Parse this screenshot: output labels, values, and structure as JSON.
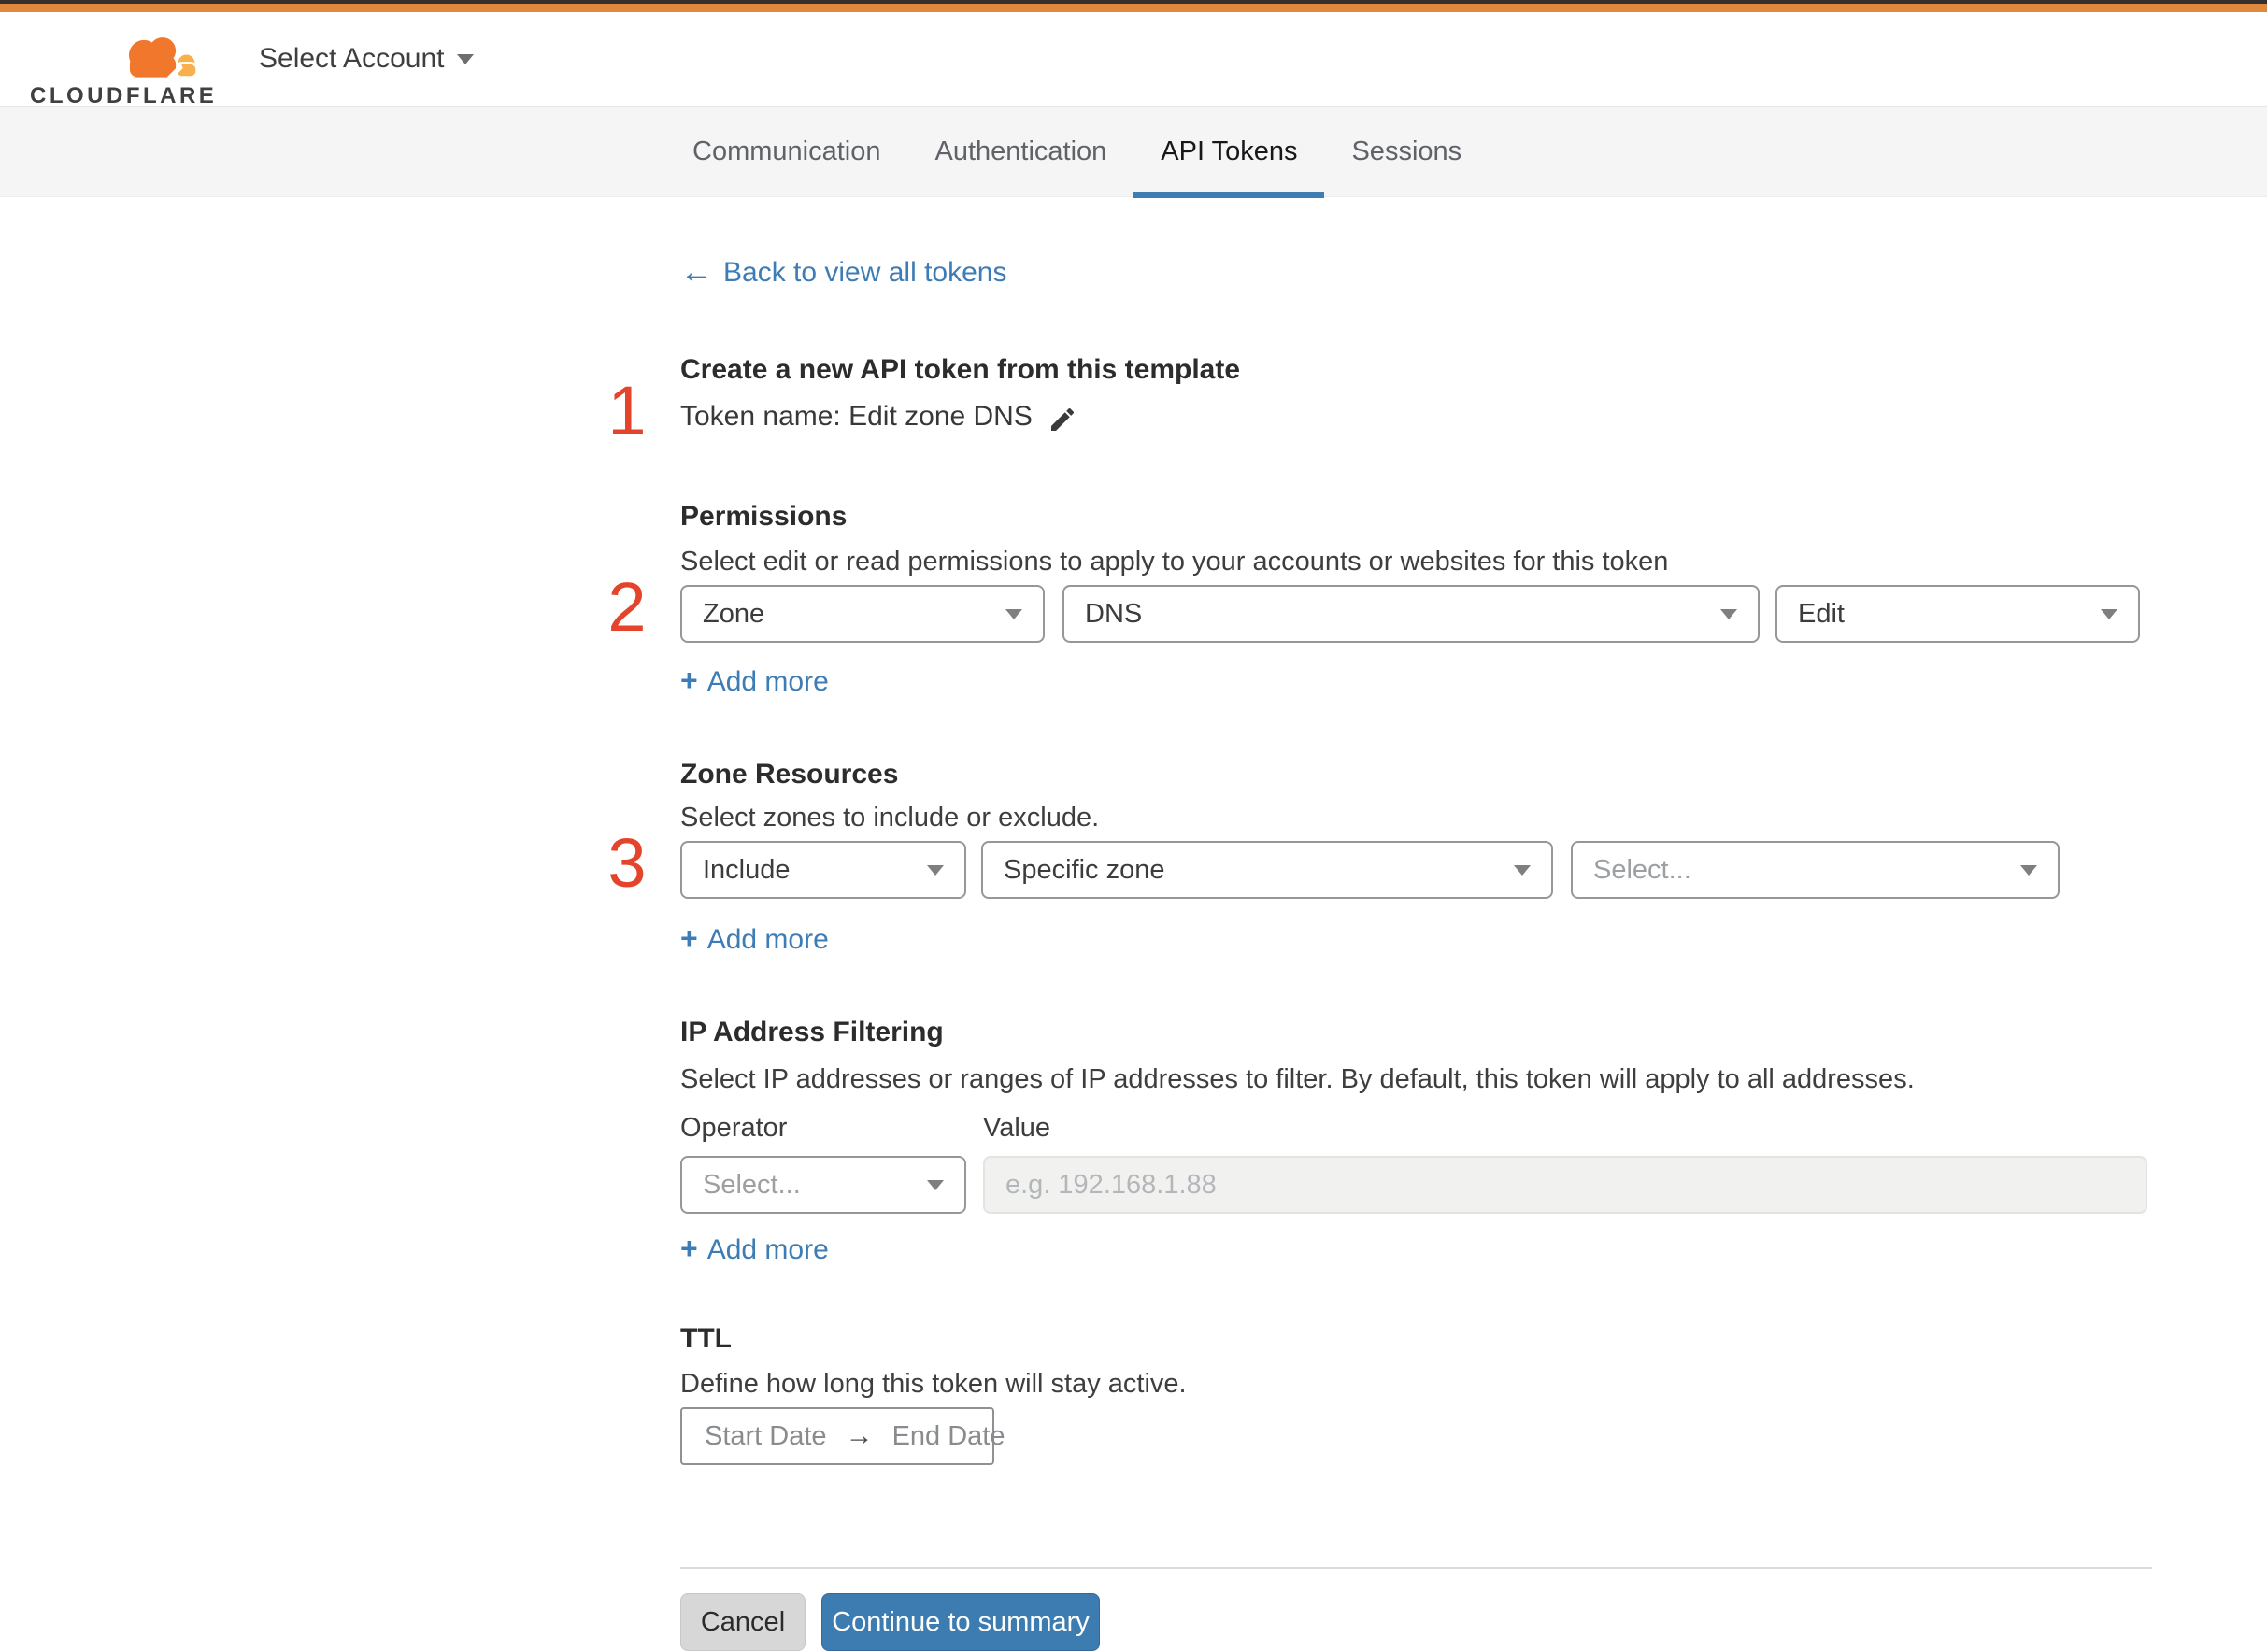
{
  "colors": {
    "top_strip": "#35302e",
    "top_bar_orange": "#e0893c",
    "tab_underline": "#3e7cb1",
    "link_blue": "#3d7cb4",
    "marker_red": "#e3442b",
    "continue_button_blue": "#3c7cb0"
  },
  "header": {
    "logo_wordmark": "CLOUDFLARE",
    "account_selector_label": "Select Account"
  },
  "tabs": [
    {
      "label": "Communication"
    },
    {
      "label": "Authentication"
    },
    {
      "label": "API Tokens"
    },
    {
      "label": "Sessions"
    }
  ],
  "back_link": {
    "arrow": "←",
    "label": "Back to view all tokens"
  },
  "step1": {
    "marker": "1",
    "title": "Create a new API token from this template",
    "token_name_line": "Token name: Edit zone DNS"
  },
  "permissions": {
    "marker": "2",
    "title": "Permissions",
    "description": "Select edit or read permissions to apply to your accounts or websites for this token",
    "scope_value": "Zone",
    "resource_value": "DNS",
    "access_value": "Edit",
    "add_more": {
      "plus": "+",
      "label": "Add more"
    }
  },
  "zone_resources": {
    "marker": "3",
    "title": "Zone Resources",
    "description": "Select zones to include or exclude.",
    "mode_value": "Include",
    "type_value": "Specific zone",
    "zone_placeholder": "Select...",
    "add_more": {
      "plus": "+",
      "label": "Add more"
    }
  },
  "ip_filtering": {
    "title": "IP Address Filtering",
    "description": "Select IP addresses or ranges of IP addresses to filter. By default, this token will apply to all addresses.",
    "operator_label": "Operator",
    "value_label": "Value",
    "operator_placeholder": "Select...",
    "value_placeholder": "e.g. 192.168.1.88",
    "add_more": {
      "plus": "+",
      "label": "Add more"
    }
  },
  "ttl": {
    "title": "TTL",
    "description": "Define how long this token will stay active.",
    "start_label": "Start Date",
    "arrow": "→",
    "end_label": "End Date"
  },
  "footer": {
    "cancel_label": "Cancel",
    "continue_label": "Continue to summary"
  }
}
